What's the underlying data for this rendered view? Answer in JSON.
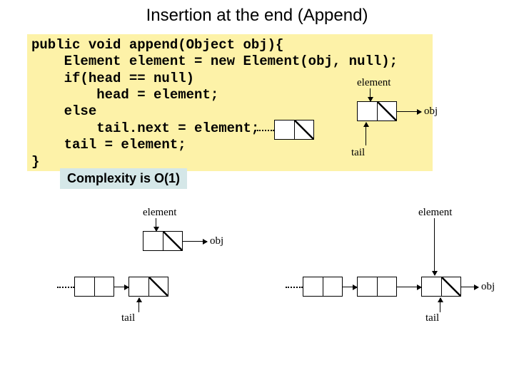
{
  "title": "Insertion at the end (Append)",
  "code": "public void append(Object obj){\n    Element element = new Element(obj, null);\n    if(head == null)\n        head = element;\n    else\n        tail.next = element;\n    tail = element;\n}",
  "complexity": "Complexity is   O(1)",
  "labels": {
    "element": "element",
    "obj": "obj",
    "tail": "tail"
  }
}
